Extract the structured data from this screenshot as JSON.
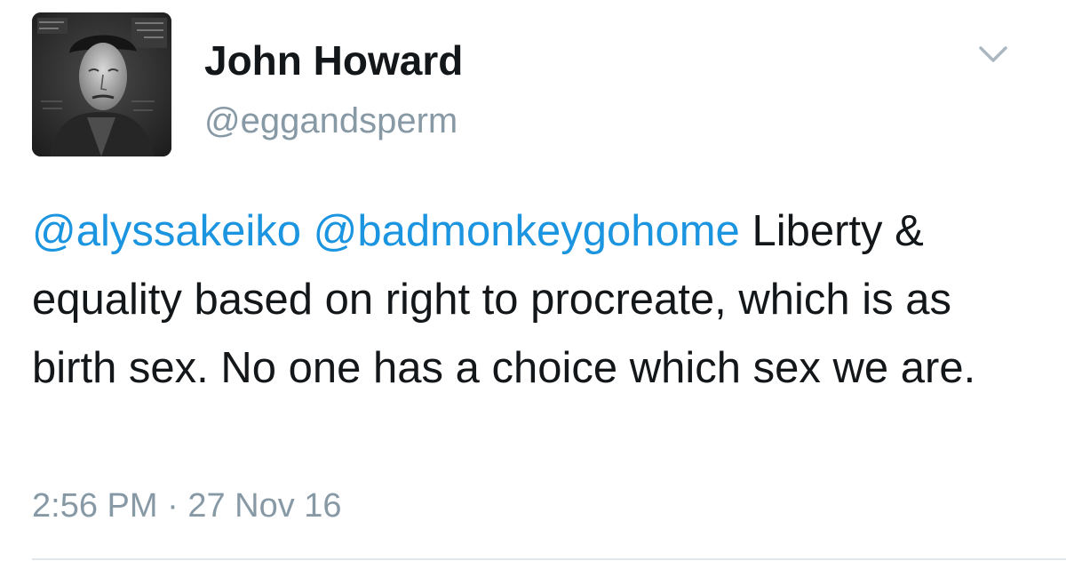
{
  "tweet": {
    "author": {
      "display_name": "John Howard",
      "handle": "@eggandsperm",
      "avatar_icon": "portrait-avatar"
    },
    "menu_icon": "chevron-down-icon",
    "mentions": [
      "@alyssakeiko",
      "@badmonkeygohome"
    ],
    "body_text": "Liberty & equality based on right to procreate, which is as birth sex. No one has a choice which sex we are.",
    "time": "2:56 PM",
    "separator": "·",
    "date": "27 Nov 16"
  },
  "colors": {
    "mention": "#1b95e0",
    "secondary_text": "#8899a6",
    "primary_text": "#14171a",
    "divider": "#e1e8ed"
  }
}
